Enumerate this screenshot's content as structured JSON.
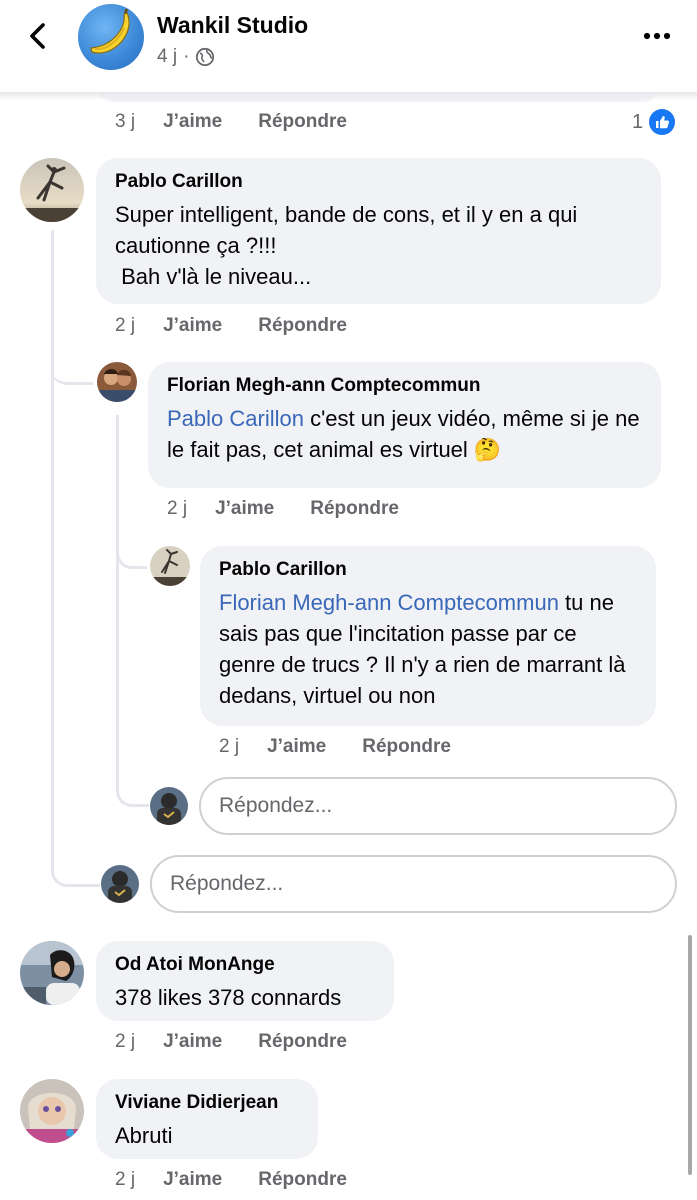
{
  "header": {
    "page_name": "Wankil Studio",
    "post_age": "4 j",
    "separator": "·"
  },
  "previous_comment": {
    "time": "3 j",
    "like_label": "J’aime",
    "reply_label": "Répondre",
    "like_count": "1"
  },
  "comments": [
    {
      "author": "Pablo Carillon",
      "text": "Super intelligent, bande de cons, et il y en a qui cautionne ça ?!!!\n Bah v'là le niveau...",
      "time": "2 j",
      "like_label": "J’aime",
      "reply_label": "Répondre",
      "replies": [
        {
          "author": "Florian Megh-ann Comptecommun",
          "mention": "Pablo Carillon",
          "text": " c'est un jeux vidéo, même si je ne le fait pas, cet animal es virtuel 🤔",
          "time": "2 j",
          "like_label": "J’aime",
          "reply_label": "Répondre"
        },
        {
          "author": "Pablo Carillon",
          "mention": "Florian Megh-ann Comptecommun",
          "text": " tu ne sais pas que l'incitation passe par ce genre de trucs ? Il n'y a rien de marrant là dedans, virtuel ou non",
          "time": "2 j",
          "like_label": "J’aime",
          "reply_label": "Répondre"
        }
      ],
      "nested_reply_placeholder": "Répondez...",
      "reply_placeholder": "Répondez..."
    },
    {
      "author": "Od Atoi MonAnge",
      "text": "378 likes 378 connards",
      "time": "2 j",
      "like_label": "J’aime",
      "reply_label": "Répondre"
    },
    {
      "author": "Viviane Didierjean",
      "text": "Abruti",
      "time": "2 j",
      "like_label": "J’aime",
      "reply_label": "Répondre"
    }
  ],
  "colors": {
    "bubble": "#f0f2f5",
    "mention": "#3a68b8",
    "secondary_text": "#65676b",
    "like_blue": "#1877f2"
  },
  "icons": [
    "back-chevron-icon",
    "globe-icon",
    "more-dots-icon",
    "like-thumb-icon"
  ]
}
